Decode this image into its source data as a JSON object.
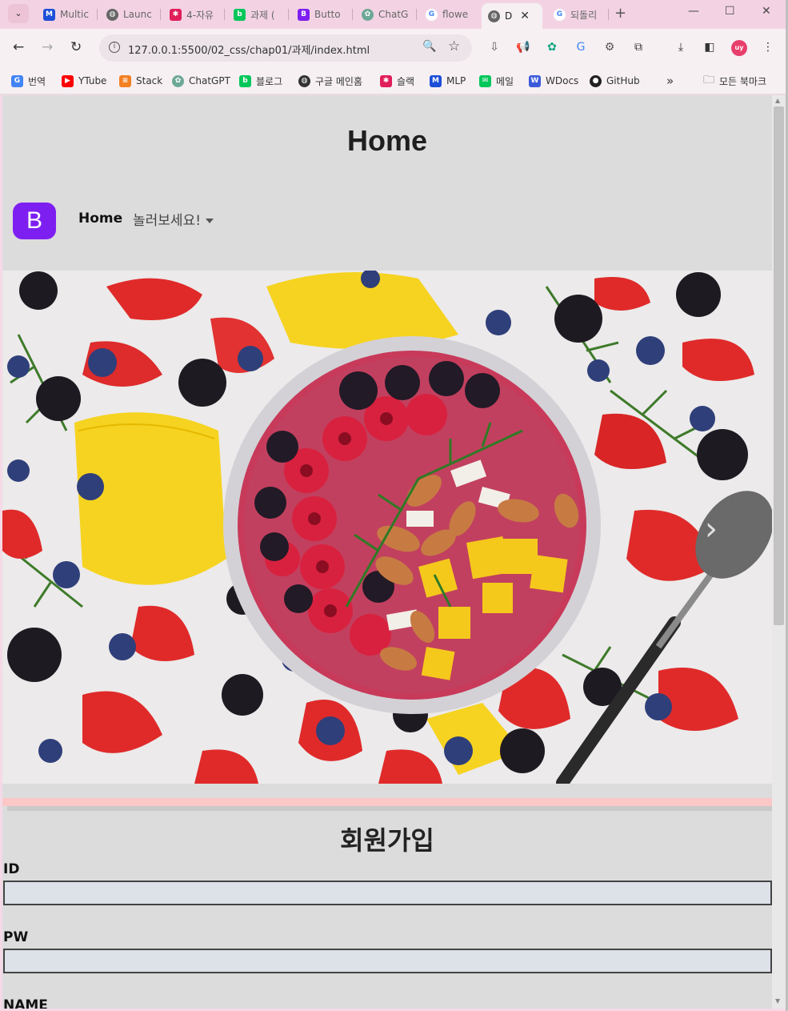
{
  "tabs": [
    {
      "title": "Multic",
      "icon": "m-icon",
      "color": "#1d4fd8",
      "glyph": "M"
    },
    {
      "title": "Launc",
      "icon": "globe-icon",
      "color": "#666666",
      "glyph": "◍"
    },
    {
      "title": "4-자유",
      "icon": "slack-icon",
      "color": "#e01e5a",
      "glyph": "✱"
    },
    {
      "title": "과제 (",
      "icon": "blog-icon",
      "color": "#03c75a",
      "glyph": "b"
    },
    {
      "title": "Butto",
      "icon": "bootstrap-icon",
      "color": "#7e1ff2",
      "glyph": "B"
    },
    {
      "title": "ChatG",
      "icon": "chatgpt-icon",
      "color": "#6da896",
      "glyph": "✿"
    },
    {
      "title": "flowe",
      "icon": "google-icon",
      "color": "#4285f4",
      "glyph": "G"
    },
    {
      "title": "D",
      "icon": "globe-icon",
      "color": "#666666",
      "glyph": "◍",
      "active": true
    },
    {
      "title": "되돌리",
      "icon": "google-icon",
      "color": "#4285f4",
      "glyph": "G"
    }
  ],
  "browser": {
    "url": "127.0.0.1:5500/02_css/chap01/과제/index.html",
    "profile_initials": "uy"
  },
  "bookmarks": [
    {
      "label": "번역",
      "icon": "translate-icon",
      "color": "#4285f4",
      "glyph": "G"
    },
    {
      "label": "YTube",
      "icon": "youtube-icon",
      "color": "#ff0000",
      "glyph": "▶"
    },
    {
      "label": "Stack",
      "icon": "stackoverflow-icon",
      "color": "#f48024",
      "glyph": "≡"
    },
    {
      "label": "ChatGPT",
      "icon": "chatgpt-icon",
      "color": "#6da896",
      "glyph": "✿"
    },
    {
      "label": "블로그",
      "icon": "blog-icon",
      "color": "#03c75a",
      "glyph": "b"
    },
    {
      "label": "구글 메인홈",
      "icon": "globe-icon",
      "color": "#333333",
      "glyph": "◍"
    },
    {
      "label": "슬랙",
      "icon": "slack-icon",
      "color": "#e01e5a",
      "glyph": "✱"
    },
    {
      "label": "MLP",
      "icon": "m-icon",
      "color": "#1d4fd8",
      "glyph": "M"
    },
    {
      "label": "메일",
      "icon": "mail-icon",
      "color": "#03c75a",
      "glyph": "✉"
    },
    {
      "label": "WDocs",
      "icon": "wdocs-icon",
      "color": "#3b5bdb",
      "glyph": "W"
    },
    {
      "label": "GitHub",
      "icon": "github-icon",
      "color": "#222222",
      "glyph": "●"
    }
  ],
  "bookmarks_more": "»",
  "all_bookmarks": "모든 북마크",
  "page": {
    "title": "Home",
    "brand_letter": "B",
    "nav_home": "Home",
    "nav_dropdown": "놀러보세요!",
    "signup_title": "회원가입",
    "fields": [
      {
        "label": "ID",
        "value": ""
      },
      {
        "label": "PW",
        "value": ""
      },
      {
        "label": "NAME",
        "value": ""
      }
    ]
  }
}
